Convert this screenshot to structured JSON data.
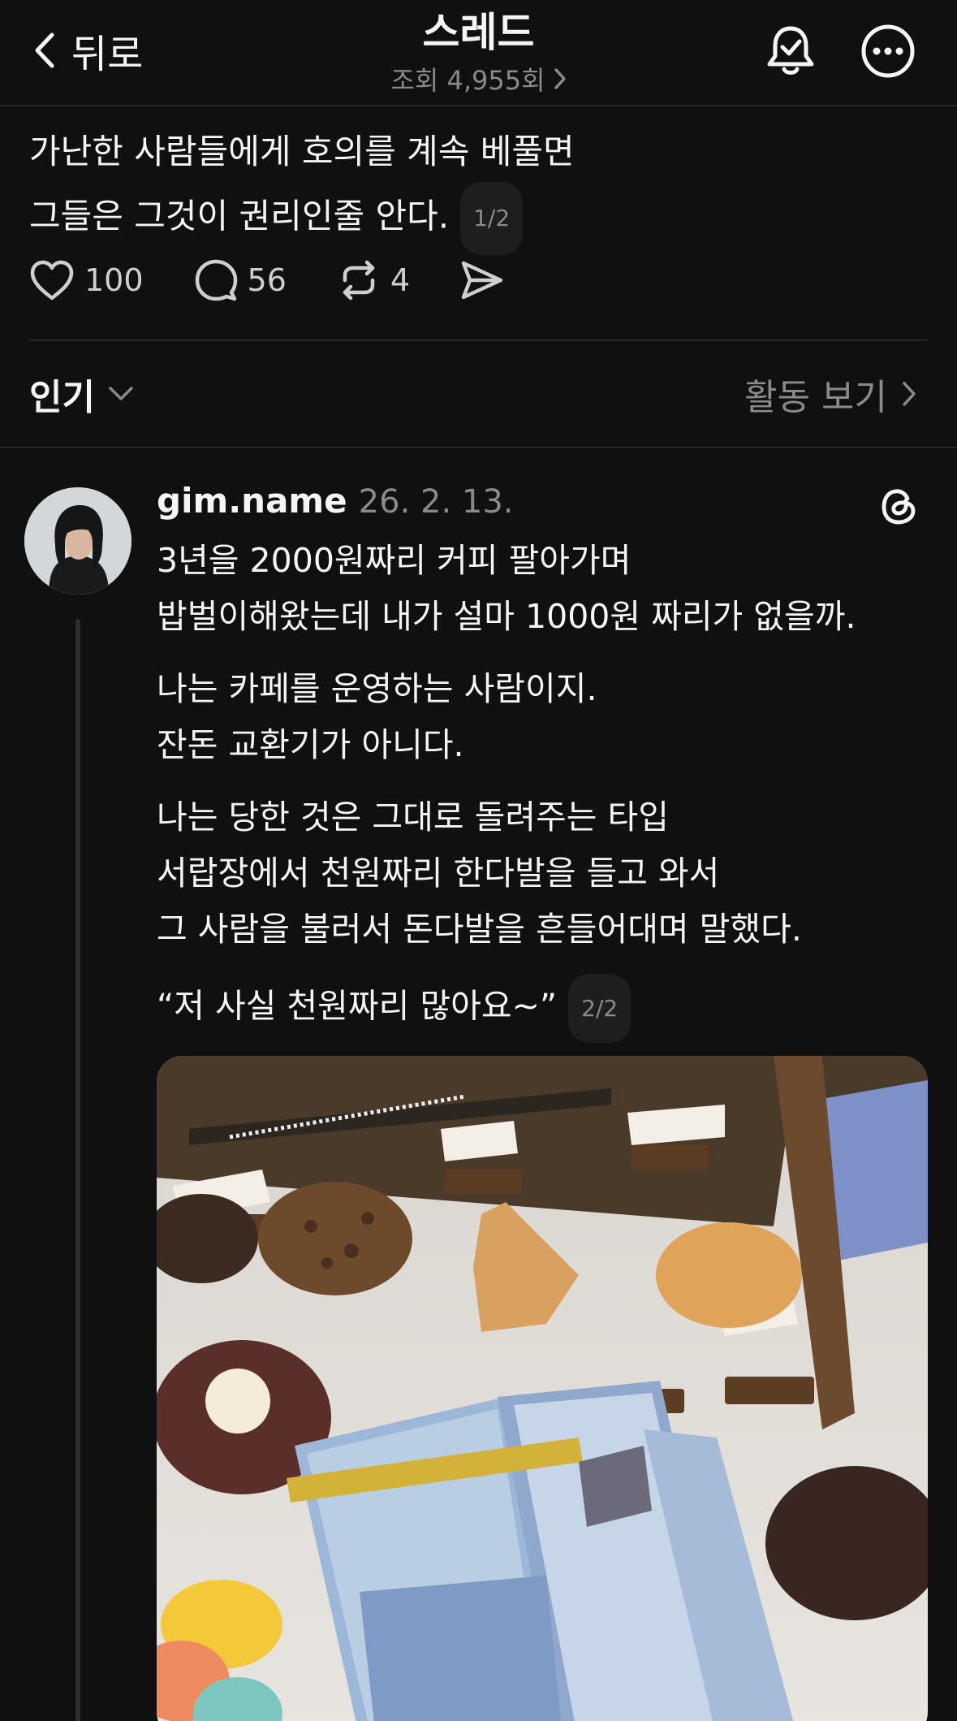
{
  "header": {
    "back_label": "뒤로",
    "title": "스레드",
    "views": "조회 4,955회",
    "notify_icon": "bell-check-icon",
    "more_icon": "more-horizontal-icon"
  },
  "original_post": {
    "lines": [
      "가난한 사람들에게 호의를 계속 베풀면",
      "그들은 그것이 권리인줄 안다."
    ],
    "pager": "1/2",
    "likes": "100",
    "replies": "56",
    "reposts": "4"
  },
  "sort": {
    "label": "인기",
    "activity_label": "활동 보기"
  },
  "reply": {
    "username": "gim.name",
    "date": "26. 2. 13.",
    "paragraphs": [
      [
        "3년을 2000원짜리 커피 팔아가며",
        "밥벌이해왔는데 내가 설마 1000원 짜리가 없을까."
      ],
      [
        "나는 카페를 운영하는 사람이지.",
        "잔돈 교환기가 아니다."
      ],
      [
        "나는 당한 것은 그대로 돌려주는 타입",
        "서랍장에서 천원짜리 한다발을 들고 와서",
        "그 사람을 불러서 돈다발을 흔들어대며 말했다."
      ],
      [
        "“저 사실 천원짜리 많아요~”"
      ]
    ],
    "pager": "2/2",
    "photo_desc_icon": "photo-cookies-cash"
  },
  "colors": {
    "background": "#101010",
    "text": "#f3f5f7",
    "muted": "#8a8a8a"
  }
}
